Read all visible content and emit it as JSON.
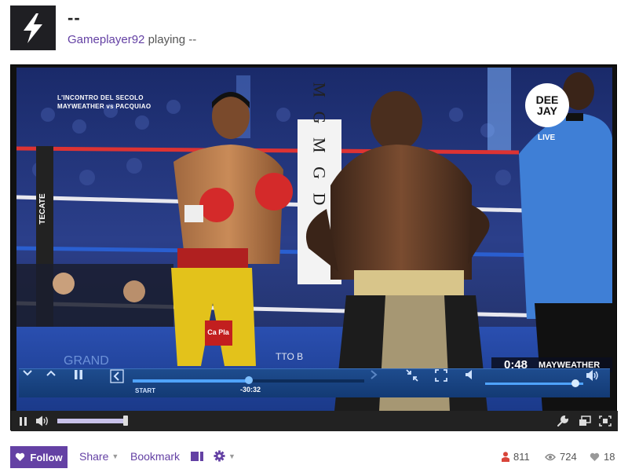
{
  "channel": {
    "title": "--",
    "username": "Gameplayer92",
    "playing_text": "playing --",
    "avatar_icon": "lightning-bolt-icon"
  },
  "video": {
    "overlay_title_line1": "L'INCONTRO DEL SECOLO",
    "overlay_title_line2": "MAYWEATHER vs PACQUIAO",
    "brand_line1": "DEE",
    "brand_line2": "JAY",
    "live_label": "LIVE",
    "score_time": "0:48",
    "score_name": "MAYWEATHER",
    "corner_post_text": "TECATE",
    "banner_text": "M G M G D",
    "trunks_text": "Ca Pla",
    "apron_text": "GRAND",
    "apron_text2": "TTO B"
  },
  "inner_controls": {
    "start_label": "START",
    "time_remaining": "-30:32",
    "seek_progress": 0.5,
    "volume_level": 0.92
  },
  "player_controls": {
    "volume_level": 1.0
  },
  "actions": {
    "follow_label": "Follow",
    "share_label": "Share",
    "bookmark_label": "Bookmark"
  },
  "stats": {
    "viewers": "811",
    "views": "724",
    "followers": "18"
  },
  "colors": {
    "brand": "#6441a4",
    "player_bg": "#222222",
    "inner_bar": "#1e4c8e",
    "viewers_icon": "#d9453a"
  }
}
